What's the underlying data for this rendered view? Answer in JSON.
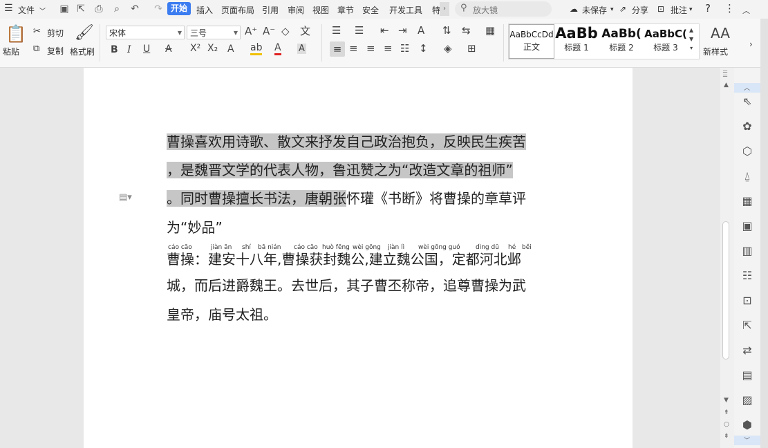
{
  "menubar": {
    "file_label": "文件",
    "tabs": [
      "开始",
      "插入",
      "页面布局",
      "引用",
      "审阅",
      "视图",
      "章节",
      "安全",
      "开发工具",
      "特"
    ],
    "search_placeholder": "放大镜",
    "unsaved_label": "未保存",
    "share_label": "分享",
    "comment_label": "批注"
  },
  "ribbon": {
    "paste_label": "粘贴",
    "cut_label": "剪切",
    "copy_label": "复制",
    "format_painter_label": "格式刷",
    "font_name": "宋体",
    "font_size": "三号",
    "styles": [
      {
        "sample": "AaBbCcDd",
        "name": "正文"
      },
      {
        "sample": "AaBb",
        "name": "标题 1"
      },
      {
        "sample": "AaBb(",
        "name": "标题 2"
      },
      {
        "sample": "AaBbC(",
        "name": "标题 3"
      }
    ],
    "new_style_label": "新样式"
  },
  "document": {
    "p1_line1": "曹操喜欢用诗歌、散文来抒发自己政治抱负，反映民生疾苦",
    "p1_line2": "，是魏晋文学的代表人物，鲁迅赞之为“改造文章的祖师”",
    "p1_line3_hl": "。同时曹操擅长书法，唐朝张",
    "p1_line3_rest": "怀瓘《书断》将曹操的章草评",
    "p1_line4": "为“妙品”",
    "p2_line1": "曹操：建安十八年,曹操获封魏公,建立魏公国，定都河北邺",
    "p2_line2": "城，而后进爵魏王。去世后，其子曹丕称帝，追尊曹操为武",
    "p2_line3": "皇帝，庙号太祖。",
    "pinyin": [
      {
        "text": "cáo cāo"
      },
      {
        "text": "jiàn ān"
      },
      {
        "text": "shí"
      },
      {
        "text": "bā nián"
      },
      {
        "text": "cáo cāo"
      },
      {
        "text": "huò fēng"
      },
      {
        "text": "wèi gōng"
      },
      {
        "text": "jiàn lì"
      },
      {
        "text": "wèi gōng guó"
      },
      {
        "text": "dìng dū"
      },
      {
        "text": "hé"
      },
      {
        "text": "běi"
      }
    ]
  }
}
